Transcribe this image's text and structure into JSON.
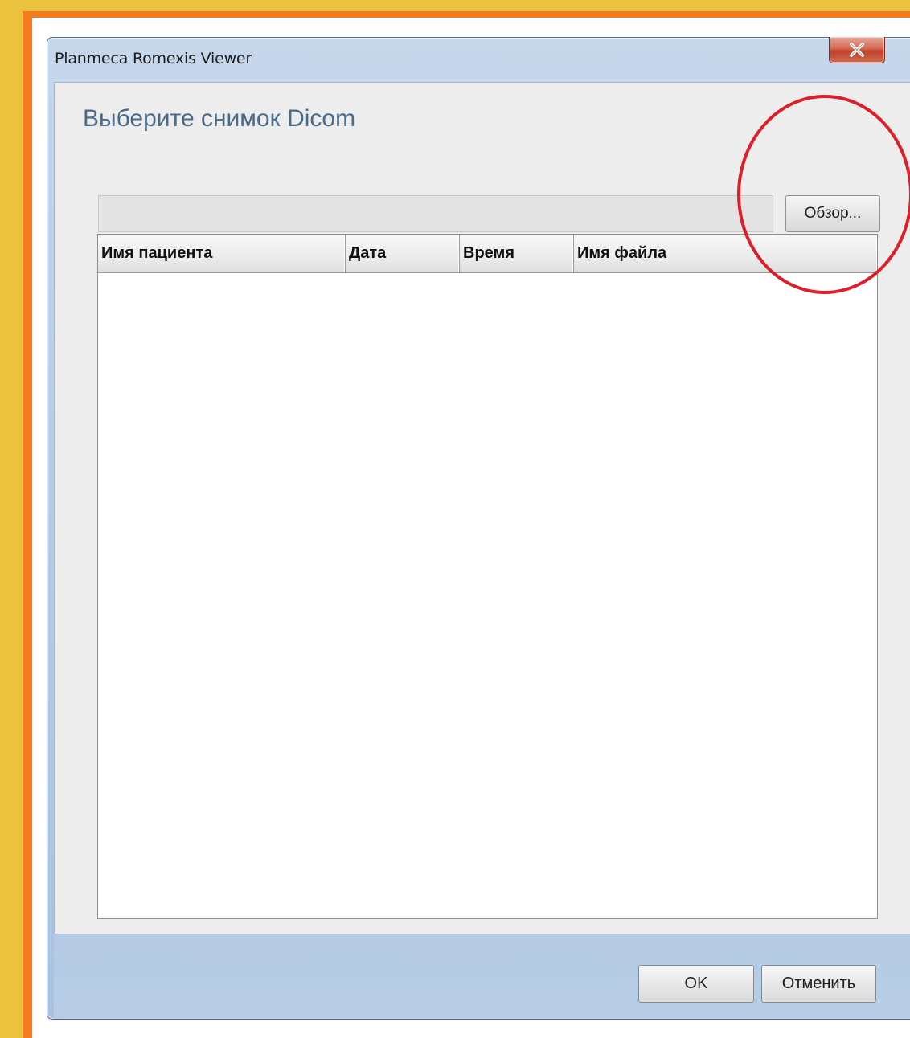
{
  "window": {
    "title": "Planmeca Romexis Viewer",
    "close_icon": "close-x-icon"
  },
  "dialog": {
    "heading": "Выберите снимок Dicom",
    "path_value": "",
    "browse_label": "Обзор..."
  },
  "table": {
    "columns": [
      "Имя пациента",
      "Дата",
      "Время",
      "Имя файла"
    ],
    "rows": []
  },
  "footer": {
    "ok_label": "OK",
    "cancel_label": "Отменить"
  },
  "colors": {
    "outer_frame": "#ebc23e",
    "inner_frame": "#f47b20",
    "heading": "#4a6a8a",
    "annotation_circle": "#dc1f2a"
  }
}
